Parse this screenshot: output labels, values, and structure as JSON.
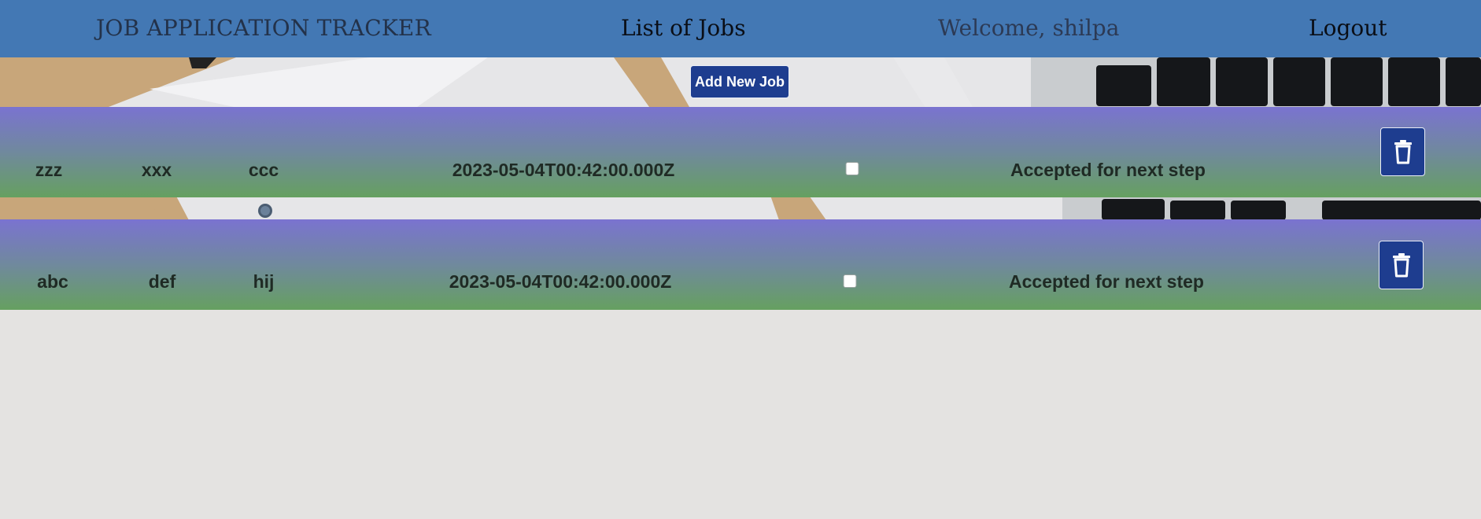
{
  "header": {
    "brand": "JOB APPLICATION TRACKER",
    "nav_list_jobs": "List of Jobs",
    "welcome": "Welcome, shilpa",
    "logout": "Logout"
  },
  "actions": {
    "add_new_job": "Add New Job"
  },
  "jobs": [
    {
      "company": "zzz",
      "position": "xxx",
      "location": "ccc",
      "date": "2023-05-04T00:42:00.000Z",
      "checked": false,
      "status": "Accepted for next step",
      "delete_icon": "trash-icon"
    },
    {
      "company": "abc",
      "position": "def",
      "location": "hij",
      "date": "2023-05-04T00:42:00.000Z",
      "checked": false,
      "status": "Accepted for next step",
      "delete_icon": "trash-icon"
    }
  ],
  "colors": {
    "navbar": "#4378b4",
    "button": "#1e3d8f",
    "row_gradient_top": "#7a73d0",
    "row_gradient_bottom": "#66a060",
    "page_background": "#e4e3e1"
  }
}
